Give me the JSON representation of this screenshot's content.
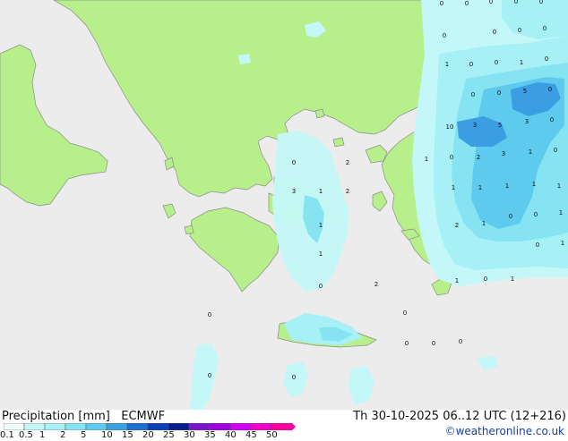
{
  "title": "Precipitation [mm]",
  "model": "ECMWF",
  "run_info": "Th 30-10-2025 06..12 UTC (12+216)",
  "credit": "©weatheronline.co.uk",
  "colors": {
    "sea": "#ececec",
    "land": "#b7f08a",
    "coast": "#8a8a8a",
    "precip_0_1": "#c4f8f8",
    "precip_0_5": "#a6f0f6",
    "precip_1": "#86e4f2",
    "precip_2": "#5ecbee",
    "precip_5": "#3c9ee2"
  },
  "legend": {
    "labels": [
      "0.1",
      "0.5",
      "1",
      "2",
      "5",
      "10",
      "15",
      "20",
      "25",
      "30",
      "35",
      "40",
      "45",
      "50"
    ],
    "swatches": [
      "#f2fdfd",
      "#c4f8f8",
      "#a6f0f6",
      "#86e4f2",
      "#5ecbee",
      "#3c9ee2",
      "#1a6fcf",
      "#0a3fb8",
      "#061e8c",
      "#7a17c9",
      "#a000e0",
      "#d000f0",
      "#f000c8",
      "#ff00a0"
    ]
  },
  "map_values": [
    "0",
    "0",
    "0",
    "0",
    "0",
    "0",
    "0",
    "0",
    "0",
    "1",
    "0",
    "0",
    "1",
    "0",
    "0",
    "0",
    "5",
    "0",
    "10",
    "3",
    "5",
    "3",
    "0",
    "1",
    "0",
    "2",
    "3",
    "1",
    "0",
    "1",
    "1",
    "1",
    "1",
    "1",
    "2",
    "1",
    "0",
    "0",
    "1",
    "0",
    "2",
    "3",
    "1",
    "2",
    "1",
    "1",
    "0",
    "2",
    "1",
    "0",
    "1",
    "0",
    "0",
    "0",
    "0",
    "0",
    "0",
    "0",
    "0",
    "1",
    "0"
  ]
}
